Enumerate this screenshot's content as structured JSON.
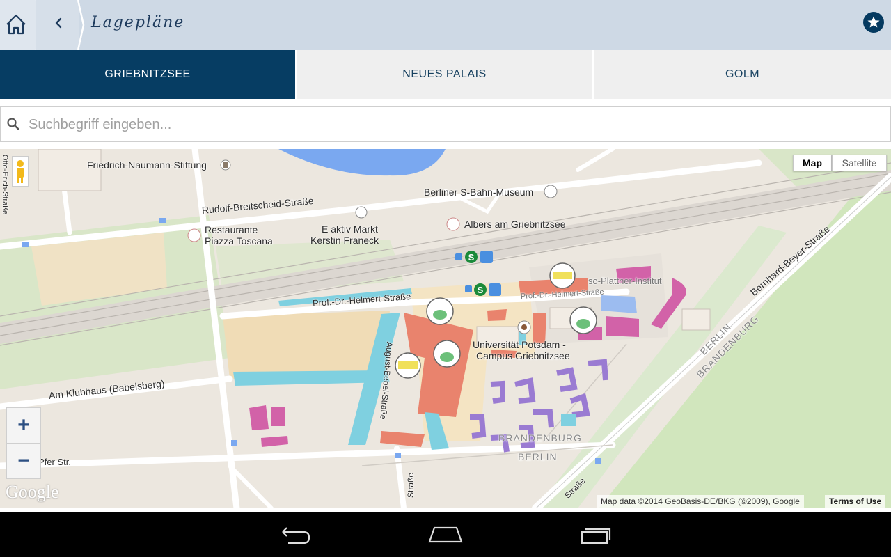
{
  "header": {
    "title": "Lagepläne",
    "home_icon": "home-icon",
    "back_icon": "chevron-left-icon",
    "favorite_icon": "star-icon"
  },
  "tabs": [
    {
      "label": "GRIEBNITZSEE",
      "active": true
    },
    {
      "label": "NEUES PALAIS",
      "active": false
    },
    {
      "label": "GOLM",
      "active": false
    }
  ],
  "search": {
    "placeholder": "Suchbegriff eingeben...",
    "value": "",
    "icon": "search-icon"
  },
  "map": {
    "type_buttons": {
      "map": "Map",
      "satellite": "Satellite"
    },
    "selected_type": "Map",
    "zoom_in": "+",
    "zoom_out": "−",
    "logo": "Google",
    "attribution": "Map data ©2014 GeoBasis-DE/BKG (©2009), Google",
    "terms": "Terms of Use",
    "labels": {
      "friedrich_naumann": "Friedrich-Naumann-Stiftung",
      "s_bahn_museum": "Berliner S-Bahn-Museum",
      "rudolf_breitscheid": "Rudolf-Breitscheid-Straße",
      "restaurante_1": "Restaurante",
      "restaurante_2": "Piazza Toscana",
      "aktiv_markt_1": "E aktiv Markt",
      "aktiv_markt_2": "Kerstin Franeck",
      "albers": "Albers am Griebnitzsee",
      "helmert": "Prof.-Dr.-Helmert-Straße",
      "helmert_2": "Prof.-Dr.-Helmert-Straße",
      "hasso": "so-Plattner-Institut",
      "uni_1": "Universität Potsdam -",
      "uni_2": "Campus Griebnitzsee",
      "klubhaus": "Am Klubhaus (Babelsberg)",
      "bernhard_beyer": "Bernhard-Beyer-Straße",
      "berlin_diag": "BERLIN",
      "brandenburg_diag": "BRANDENBURG",
      "brandenburg_h": "BRANDENBURG",
      "berlin_h": "BERLIN",
      "august_bebel": "August-Bebel-Straße",
      "strasse_bottom": "Straße",
      "strasse_br": "Straße",
      "pfer_str": "Pfer Str.",
      "otto_erich": "Otto-Erich-Straße"
    }
  },
  "colors": {
    "header_bg": "#ced9e5",
    "tab_active_bg": "#063d63",
    "tab_inactive_bg": "#efefef",
    "accent": "#053a60",
    "map_land": "#ece7df",
    "map_water": "#7aa8f0",
    "park": "#cfe5c0",
    "building_salmon": "#e9836d",
    "building_magenta": "#d262a8",
    "building_purple": "#9a7bd2",
    "building_cyan": "#7fd0e0"
  },
  "system_nav": {
    "back_icon": "android-back-icon",
    "home_icon": "android-home-icon",
    "recents_icon": "android-recents-icon"
  }
}
